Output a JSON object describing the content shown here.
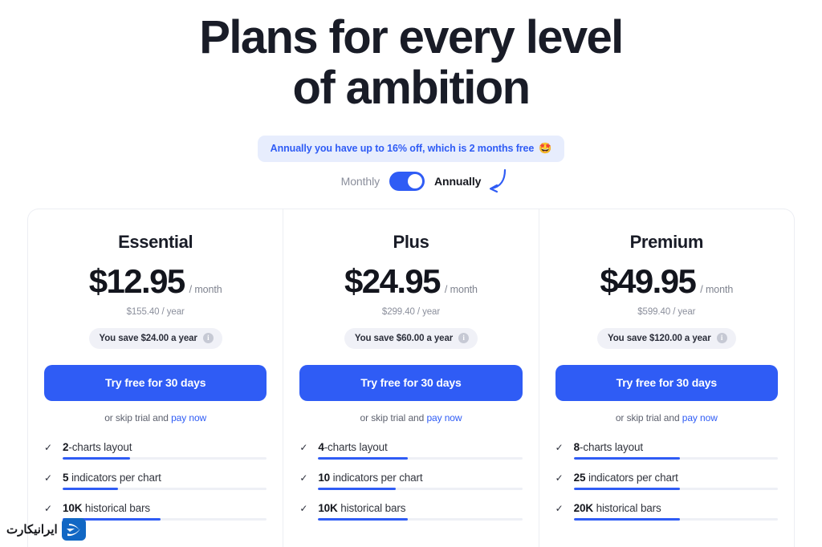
{
  "heading": {
    "line1": "Plans for every level",
    "line2": "of ambition"
  },
  "promo": {
    "text": "Annually you have up to 16% off, which is 2 months free",
    "emoji": "🤩",
    "accent_color": "#2f5cf5",
    "background_color": "#e7edfd"
  },
  "billing_toggle": {
    "monthly_label": "Monthly",
    "annually_label": "Annually",
    "selected": "Annually",
    "switch_on": true,
    "arrow_icon": "curved-arrow-left"
  },
  "plans": [
    {
      "name": "Essential",
      "price": "$12.95",
      "period": "/ month",
      "yearly": "$155.40 / year",
      "save_text": "You save $24.00 a year",
      "info_icon": "info-icon",
      "cta_label": "Try free for 30 days",
      "skip_prefix": "or skip trial and",
      "skip_link": "pay now",
      "features": [
        {
          "value": "2",
          "text": "-charts layout",
          "fill_percent": 33
        },
        {
          "value": "5",
          "text": " indicators per chart",
          "fill_percent": 27
        },
        {
          "value": "10K",
          "text": " historical bars",
          "fill_percent": 48
        }
      ]
    },
    {
      "name": "Plus",
      "price": "$24.95",
      "period": "/ month",
      "yearly": "$299.40 / year",
      "save_text": "You save $60.00 a year",
      "info_icon": "info-icon",
      "cta_label": "Try free for 30 days",
      "skip_prefix": "or skip trial and",
      "skip_link": "pay now",
      "features": [
        {
          "value": "4",
          "text": "-charts layout",
          "fill_percent": 44
        },
        {
          "value": "10",
          "text": " indicators per chart",
          "fill_percent": 38
        },
        {
          "value": "10K",
          "text": " historical bars",
          "fill_percent": 44
        }
      ]
    },
    {
      "name": "Premium",
      "price": "$49.95",
      "period": "/ month",
      "yearly": "$599.40 / year",
      "save_text": "You save $120.00 a year",
      "info_icon": "info-icon",
      "cta_label": "Try free for 30 days",
      "skip_prefix": "or skip trial and",
      "skip_link": "pay now",
      "features": [
        {
          "value": "8",
          "text": "-charts layout",
          "fill_percent": 52
        },
        {
          "value": "25",
          "text": " indicators per chart",
          "fill_percent": 52
        },
        {
          "value": "20K",
          "text": " historical bars",
          "fill_percent": 52
        }
      ]
    }
  ],
  "watermark": {
    "text": "ایرانیکارت",
    "logo_color": "#1167c4"
  }
}
